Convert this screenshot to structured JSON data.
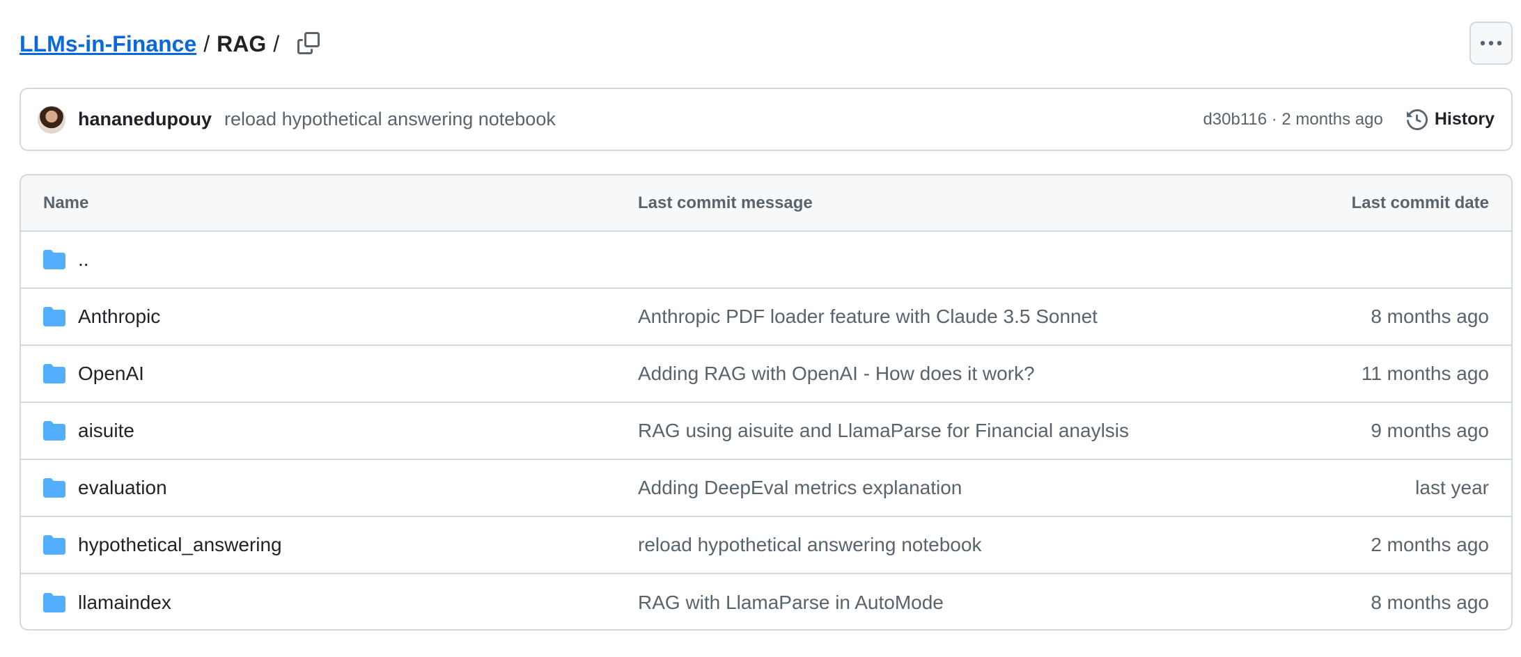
{
  "breadcrumb": {
    "repo": "LLMs-in-Finance",
    "separator": "/",
    "current": "RAG",
    "trailing": "/"
  },
  "icons": {
    "copy": "copy-icon",
    "more": "kebab-horizontal-icon",
    "history": "history-icon",
    "folder": "folder-icon"
  },
  "latest_commit": {
    "author": "hananedupouy",
    "message": "reload hypothetical answering notebook",
    "meta": "d30b116 · 2 months ago",
    "history_label": "History"
  },
  "table": {
    "headers": {
      "name": "Name",
      "message": "Last commit message",
      "date": "Last commit date"
    },
    "rows": [
      {
        "name": "..",
        "message": "",
        "date": ""
      },
      {
        "name": "Anthropic",
        "message": "Anthropic PDF loader feature with Claude 3.5 Sonnet",
        "date": "8 months ago"
      },
      {
        "name": "OpenAI",
        "message": "Adding RAG with OpenAI - How does it work?",
        "date": "11 months ago"
      },
      {
        "name": "aisuite",
        "message": "RAG using aisuite and LlamaParse for Financial anaylsis",
        "date": "9 months ago"
      },
      {
        "name": "evaluation",
        "message": "Adding DeepEval metrics explanation",
        "date": "last year"
      },
      {
        "name": "hypothetical_answering",
        "message": "reload hypothetical answering notebook",
        "date": "2 months ago"
      },
      {
        "name": "llamaindex",
        "message": "RAG with LlamaParse in AutoMode",
        "date": "8 months ago"
      }
    ]
  },
  "colors": {
    "link": "#0969da",
    "folder": "#54aeff",
    "border": "#d1d9e0",
    "muted_text": "#59636e",
    "header_bg": "#f6f8fa"
  }
}
